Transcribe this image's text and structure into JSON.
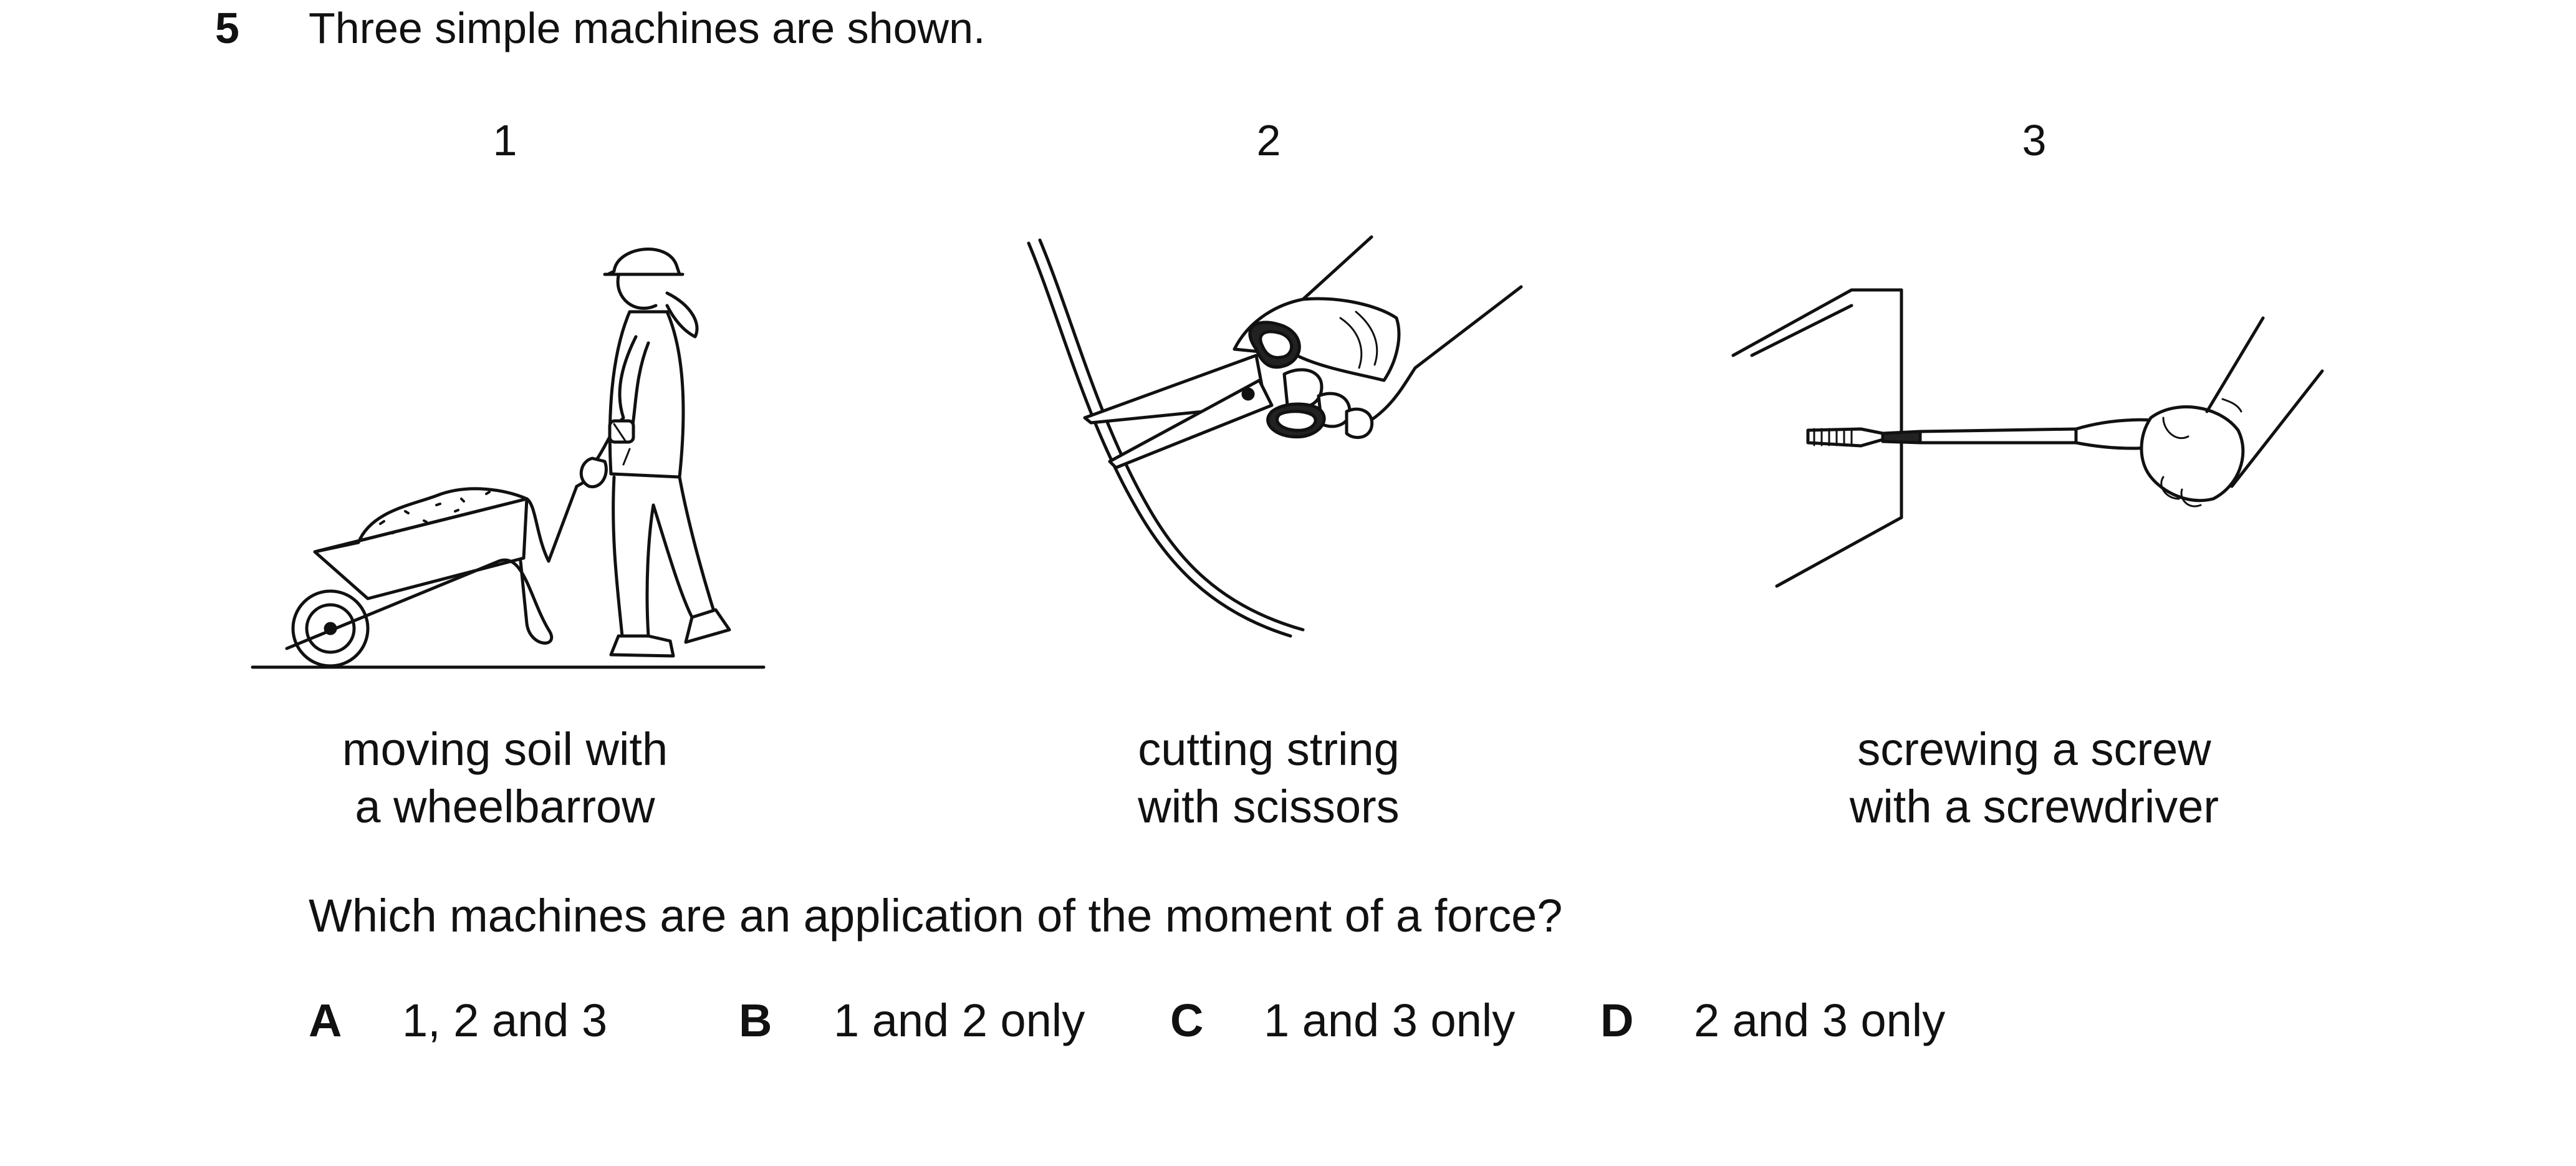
{
  "question": {
    "number": "5",
    "prompt": "Three simple machines are shown.",
    "ask": "Which machines are an application of the moment of a force?"
  },
  "figures": [
    {
      "label": "1",
      "caption_line1": "moving soil with",
      "caption_line2": "a wheelbarrow"
    },
    {
      "label": "2",
      "caption_line1": "cutting string",
      "caption_line2": "with scissors"
    },
    {
      "label": "3",
      "caption_line1": "screwing a screw",
      "caption_line2": "with a screwdriver"
    }
  ],
  "options": [
    {
      "letter": "A",
      "text": "1, 2 and 3"
    },
    {
      "letter": "B",
      "text": "1 and 2 only"
    },
    {
      "letter": "C",
      "text": "1 and 3 only"
    },
    {
      "letter": "D",
      "text": "2 and 3 only"
    }
  ]
}
